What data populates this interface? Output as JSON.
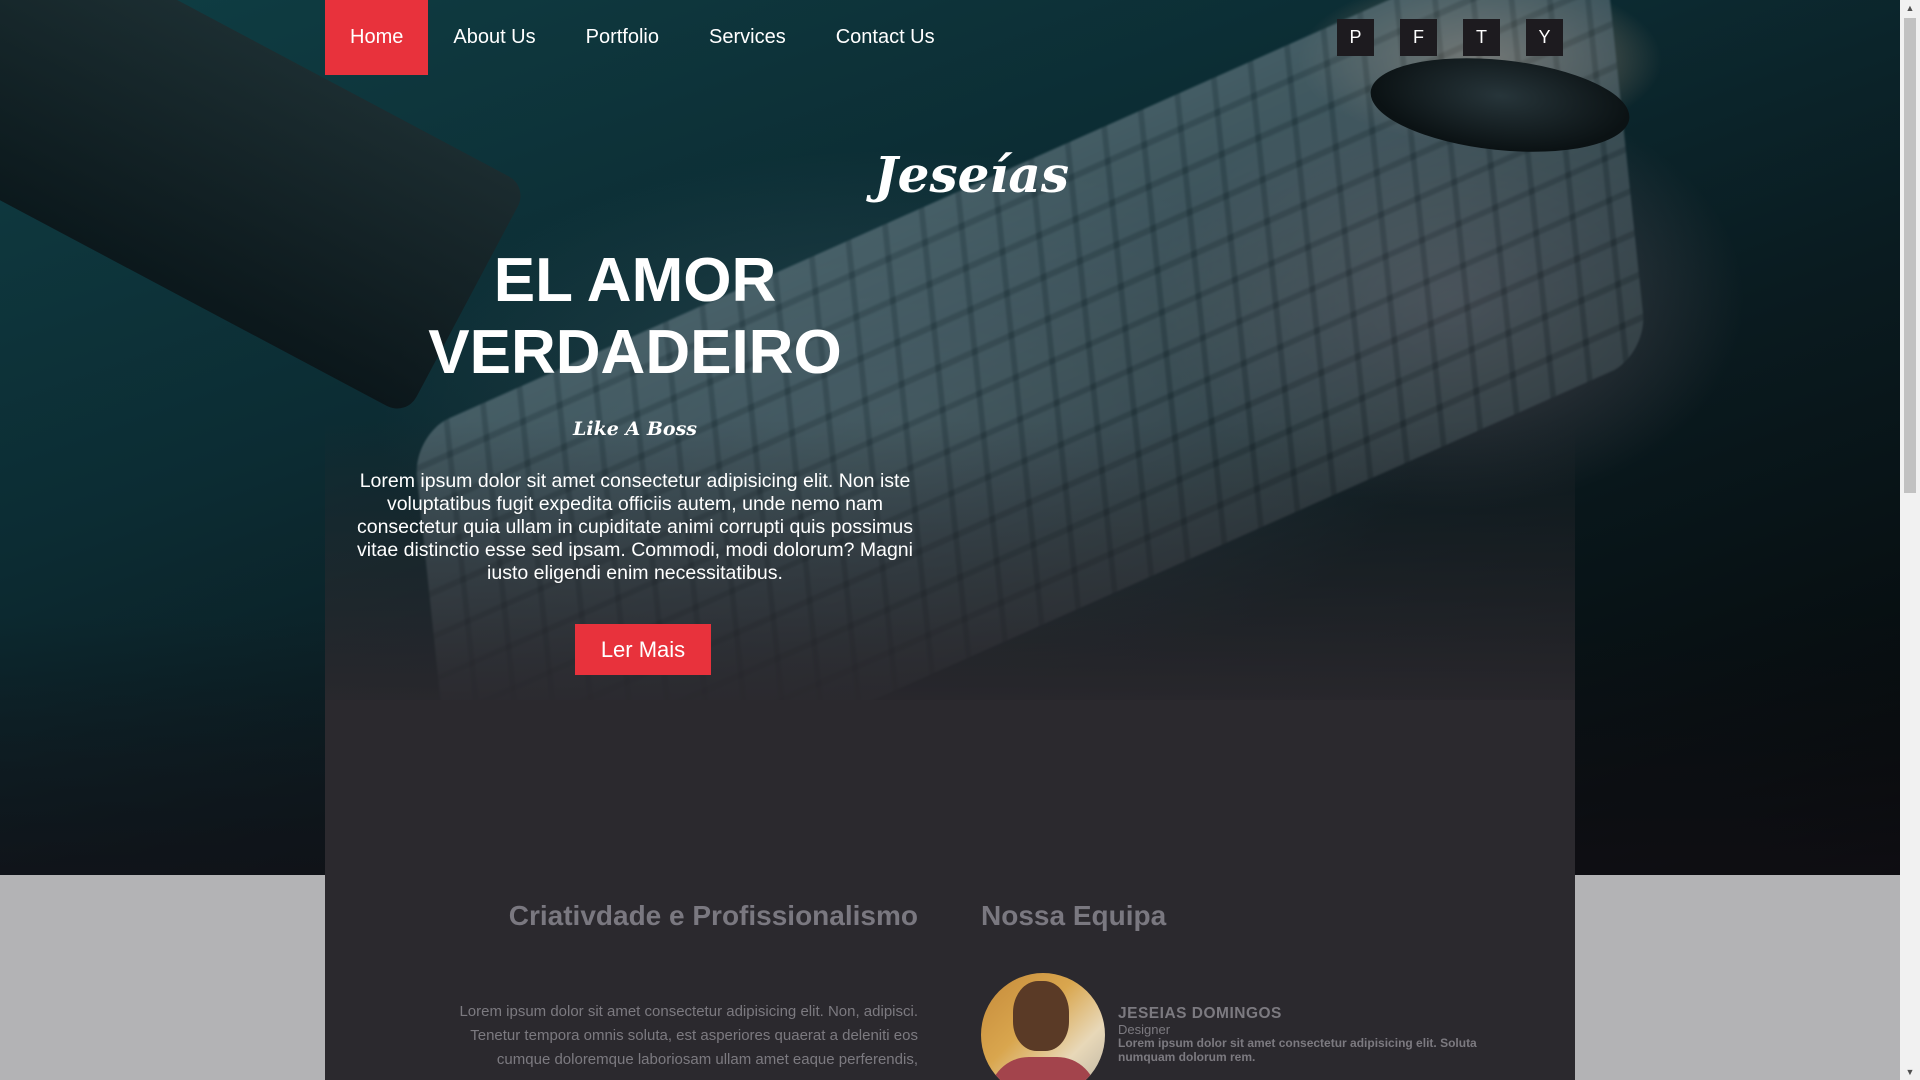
{
  "nav": {
    "items": [
      {
        "label": "Home",
        "active": true
      },
      {
        "label": "About Us",
        "active": false
      },
      {
        "label": "Portfolio",
        "active": false
      },
      {
        "label": "Services",
        "active": false
      },
      {
        "label": "Contact Us",
        "active": false
      }
    ]
  },
  "social": [
    "P",
    "F",
    "T",
    "Y"
  ],
  "hero": {
    "logo": "Jeseías",
    "headline_line1": "EL AMOR",
    "headline_line2": "VERDADEIRO",
    "tagline": "Like A Boss",
    "intro": "Lorem ipsum dolor sit amet consectetur adipisicing elit. Non iste voluptatibus fugit expedita officiis autem, unde nemo nam consectetur quia ullam in cupiditate animi corrupti quis possimus vitae distinctio esse sed ipsam. Commodi, modi dolorum? Magni iusto eligendi enim necessitatibus.",
    "cta": "Ler Mais"
  },
  "about": {
    "title": "Criativdade e Profissionalismo",
    "text": "Lorem ipsum dolor sit amet consectetur adipisicing elit. Non, adipisci. Tenetur tempora omnis soluta, est asperiores quaerat a deleniti eos cumque doloremque laboriosam ullam amet eaque perferendis,"
  },
  "team": {
    "title": "Nossa Equipa",
    "member": {
      "name": "JESEIAS DOMINGOS",
      "role": "Designer",
      "bio": "Lorem ipsum dolor sit amet consectetur adipisicing elit. Soluta numquam dolorum rem."
    }
  },
  "colors": {
    "accent": "#e8323c",
    "panel": "#2b292e",
    "muted_text": "#7c7a80"
  },
  "icons": {
    "scroll_up": "triangle-up-icon",
    "scroll_down": "triangle-down-icon"
  }
}
